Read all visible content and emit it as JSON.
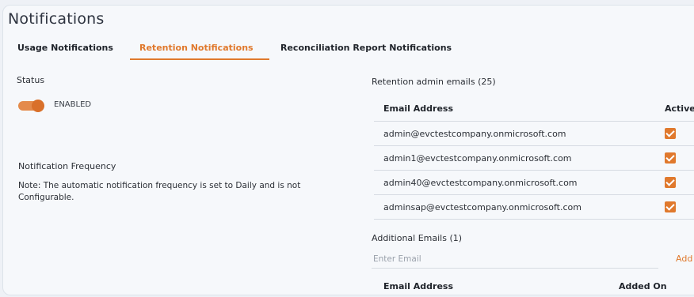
{
  "page": {
    "title": "Notifications"
  },
  "tabs": [
    {
      "label": "Usage Notifications",
      "active": false
    },
    {
      "label": "Retention Notifications",
      "active": true
    },
    {
      "label": "Reconciliation Report Notifications",
      "active": false
    }
  ],
  "status": {
    "label": "Status",
    "toggle_on": true,
    "toggle_text": "ENABLED"
  },
  "frequency": {
    "title": "Notification Frequency",
    "note": "Note: The automatic notification frequency is set to Daily and is not Configurable."
  },
  "retention_admins": {
    "title": "Retention admin emails (25)",
    "columns": [
      "Email Address",
      "Active"
    ],
    "rows": [
      {
        "email": "admin@evctestcompany.onmicrosoft.com",
        "active": true
      },
      {
        "email": "admin1@evctestcompany.onmicrosoft.com",
        "active": true
      },
      {
        "email": "admin40@evctestcompany.onmicrosoft.com",
        "active": true
      },
      {
        "email": "adminsap@evctestcompany.onmicrosoft.com",
        "active": true
      }
    ]
  },
  "additional_emails": {
    "title": "Additional Emails (1)",
    "input_placeholder": "Enter Email",
    "input_value": "",
    "add_label": "Add",
    "columns": [
      "Email Address",
      "Added On"
    ]
  },
  "colors": {
    "accent": "#e0792d",
    "background": "#f6f8fb",
    "text": "#2b2f36"
  }
}
